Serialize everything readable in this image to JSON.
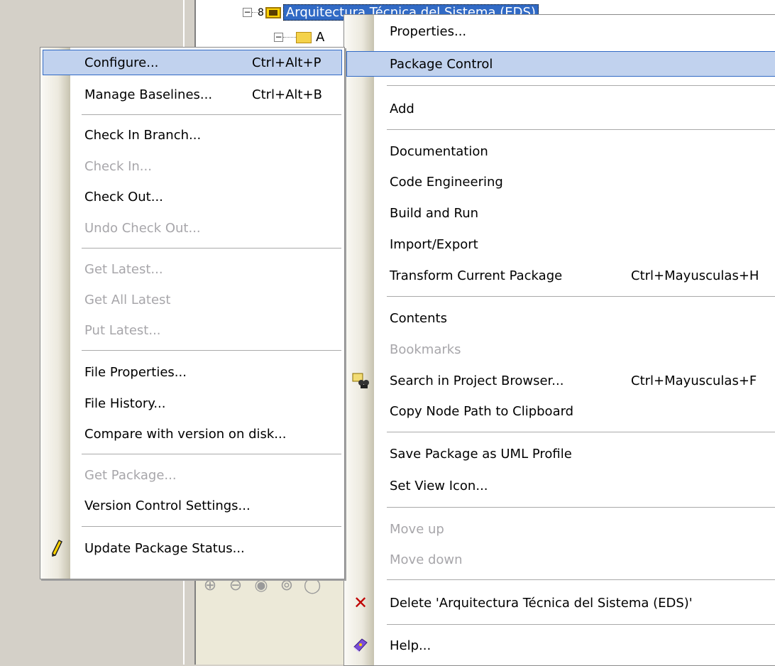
{
  "tree": {
    "root_label": "Arquitectura Técnica del Sistema (EDS)",
    "child_label": "A"
  },
  "zoom_icons": [
    "zoom-in",
    "zoom-out",
    "zoom-fit",
    "zoom-normal",
    "zoom-select"
  ],
  "context_menu": {
    "items": {
      "properties": "Properties...",
      "package_control": "Package Control",
      "add": "Add",
      "documentation": "Documentation",
      "code_engineering": "Code Engineering",
      "build_and_run": "Build and Run",
      "import_export": "Import/Export",
      "transform": "Transform Current Package",
      "transform_shortcut": "Ctrl+Mayusculas+H",
      "contents": "Contents",
      "bookmarks": "Bookmarks",
      "search": "Search in Project Browser...",
      "search_shortcut": "Ctrl+Mayusculas+F",
      "copy_path": "Copy Node Path to Clipboard",
      "save_uml": "Save Package as UML Profile",
      "set_view_icon": "Set View Icon...",
      "move_up": "Move up",
      "move_down": "Move down",
      "delete": "Delete 'Arquitectura Técnica del  Sistema (EDS)'",
      "help": "Help..."
    }
  },
  "submenu": {
    "items": {
      "configure": "Configure...",
      "configure_shortcut": "Ctrl+Alt+P",
      "manage_baselines": "Manage Baselines...",
      "manage_baselines_shortcut": "Ctrl+Alt+B",
      "check_in_branch": "Check In Branch...",
      "check_in": "Check In...",
      "check_out": "Check Out...",
      "undo_check_out": "Undo Check Out...",
      "get_latest": "Get Latest...",
      "get_all_latest": "Get All Latest",
      "put_latest": "Put Latest...",
      "file_properties": "File Properties...",
      "file_history": "File History...",
      "compare": "Compare with version on disk...",
      "get_package": "Get Package...",
      "vc_settings": "Version Control Settings...",
      "update_status": "Update Package Status..."
    }
  },
  "colors": {
    "highlight_bg": "#c1d2ee",
    "highlight_border": "#316ac5",
    "disabled_text": "#a7a6aa"
  }
}
